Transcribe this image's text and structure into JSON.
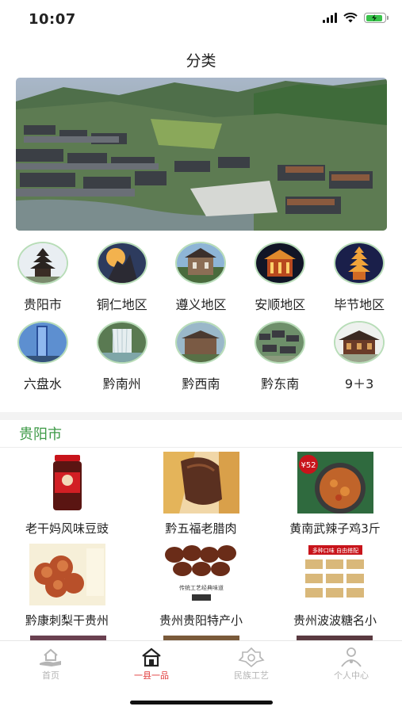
{
  "status_bar": {
    "time": "10:07",
    "battery_level": 0.9
  },
  "nav": {
    "title": "分类"
  },
  "regions": [
    {
      "label": "贵阳市"
    },
    {
      "label": "铜仁地区"
    },
    {
      "label": "遵义地区"
    },
    {
      "label": "安顺地区"
    },
    {
      "label": "毕节地区"
    },
    {
      "label": "六盘水"
    },
    {
      "label": "黔南州"
    },
    {
      "label": "黔西南"
    },
    {
      "label": "黔东南"
    },
    {
      "label": "9＋3"
    }
  ],
  "section": {
    "title": "贵阳市"
  },
  "products": [
    {
      "name": "老干妈风味豆豉",
      "badge": ""
    },
    {
      "name": "黔五福老腊肉",
      "badge": ""
    },
    {
      "name": "黄南武辣子鸡3斤",
      "badge": "¥52"
    },
    {
      "name": "黔康刺梨干贵州",
      "badge": ""
    },
    {
      "name": "贵州贵阳特产小",
      "badge": "传统工艺经典味道"
    },
    {
      "name": "贵州波波糖名小",
      "badge": "多种口味 自由搭配"
    }
  ],
  "tabs": [
    {
      "label": "首页",
      "icon": "home-hand-icon"
    },
    {
      "label": "一县一品",
      "icon": "house-icon"
    },
    {
      "label": "民族工艺",
      "icon": "craft-icon"
    },
    {
      "label": "个人中心",
      "icon": "person-icon"
    }
  ],
  "colors": {
    "accent": "#3d9a46",
    "active_tab": "#e03a3a",
    "inactive_tab": "#b5b5b5"
  }
}
